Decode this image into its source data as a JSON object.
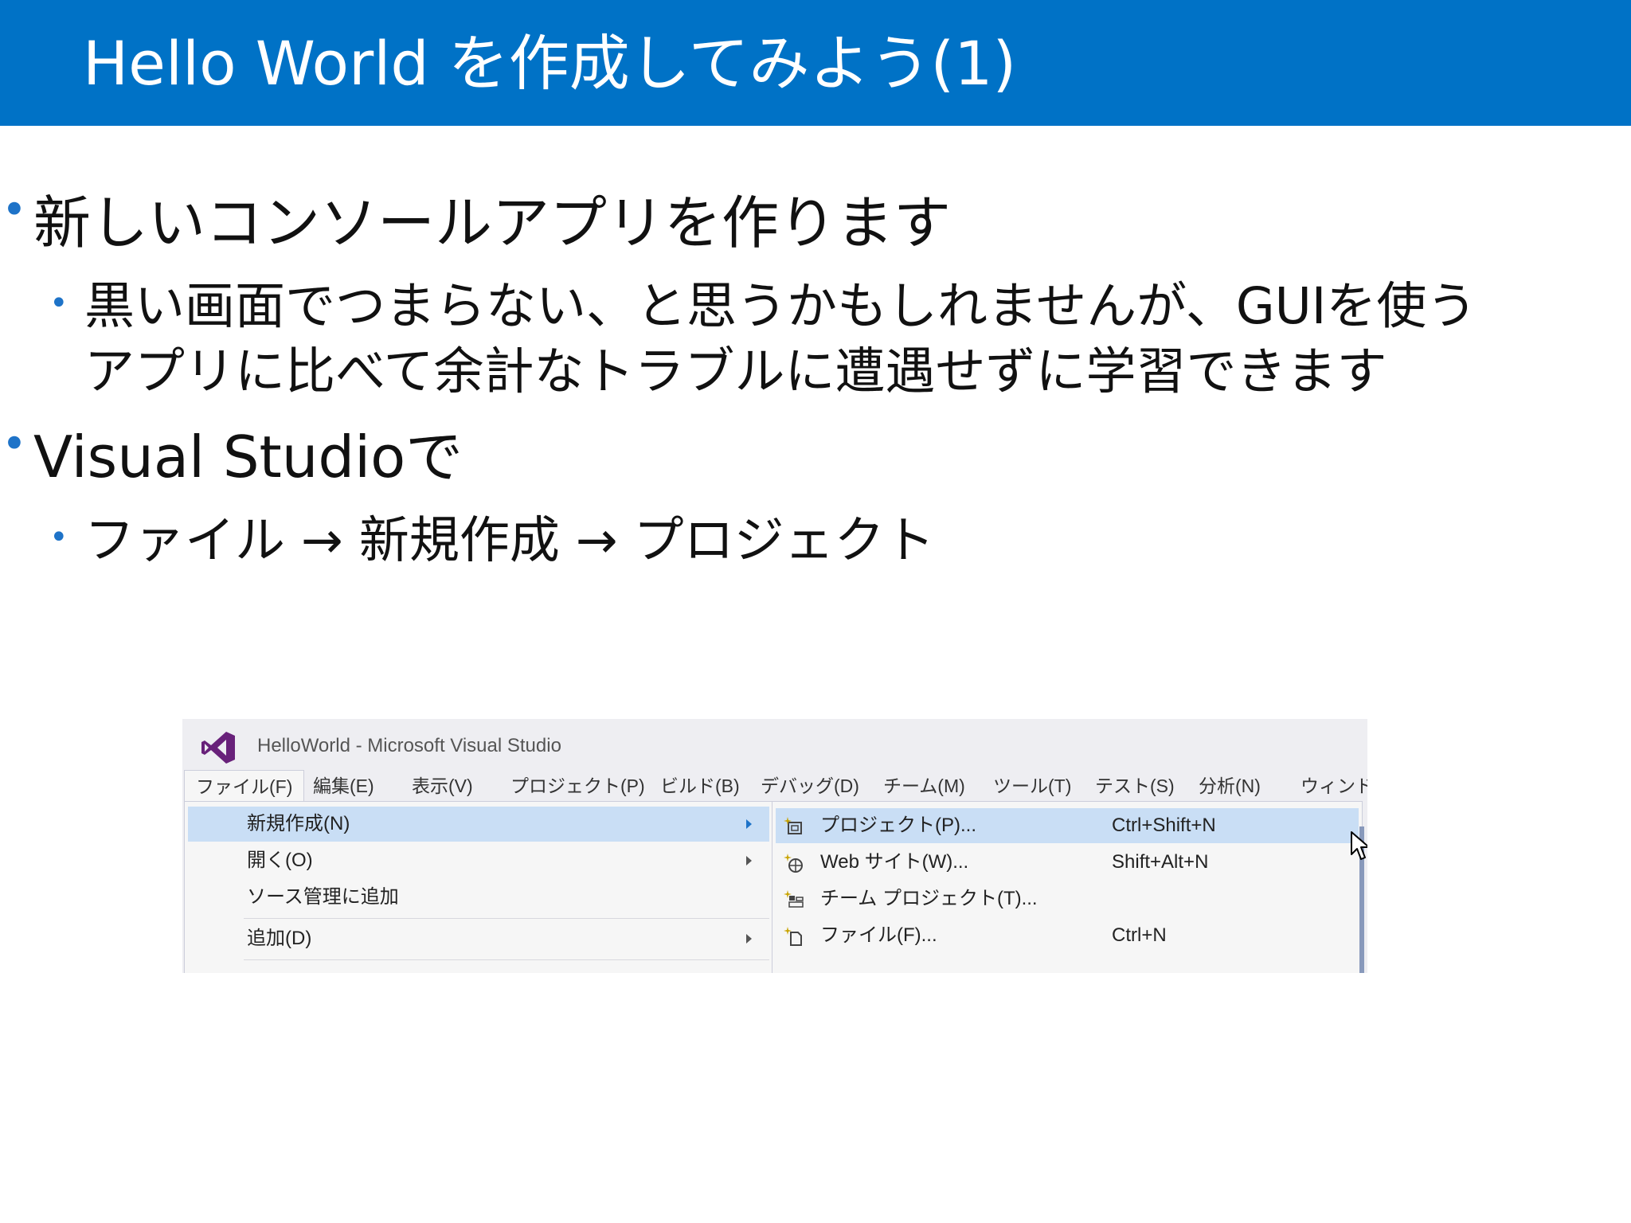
{
  "slide": {
    "title": "Hello World を作成してみよう(1)",
    "bullets": [
      {
        "text": "新しいコンソールアプリを作ります"
      },
      {
        "line1": "黒い画面でつまらない、と思うかもしれませんが、GUIを使う",
        "line2": "アプリに比べて余計なトラブルに遭遇せずに学習できます"
      },
      {
        "text": "Visual Studioで"
      },
      {
        "text": "ファイル → 新規作成 → プロジェクト"
      }
    ]
  },
  "vs": {
    "window_title": "HelloWorld - Microsoft Visual Studio",
    "menubar": [
      "ファイル(F)",
      "編集(E)",
      "表示(V)",
      "プロジェクト(P)",
      "ビルド(B)",
      "デバッグ(D)",
      "チーム(M)",
      "ツール(T)",
      "テスト(S)",
      "分析(N)",
      "ウィンドウ"
    ],
    "file_menu": [
      {
        "label": "新規作成(N)"
      },
      {
        "label": "開く(O)"
      },
      {
        "label": "ソース管理に追加"
      },
      {
        "label": "追加(D)"
      }
    ],
    "new_submenu": [
      {
        "label": "プロジェクト(P)...",
        "shortcut": "Ctrl+Shift+N",
        "icon": "new-project-icon"
      },
      {
        "label": "Web サイト(W)...",
        "shortcut": "Shift+Alt+N",
        "icon": "new-website-icon"
      },
      {
        "label": "チーム プロジェクト(T)...",
        "shortcut": "",
        "icon": "team-project-icon"
      },
      {
        "label": "ファイル(F)...",
        "shortcut": "Ctrl+N",
        "icon": "new-file-icon"
      }
    ],
    "colors": {
      "title_bar": "#0072c6",
      "bullet": "#1e73c8",
      "vs_logo": "#68217a",
      "highlight": "#c9def5"
    }
  }
}
